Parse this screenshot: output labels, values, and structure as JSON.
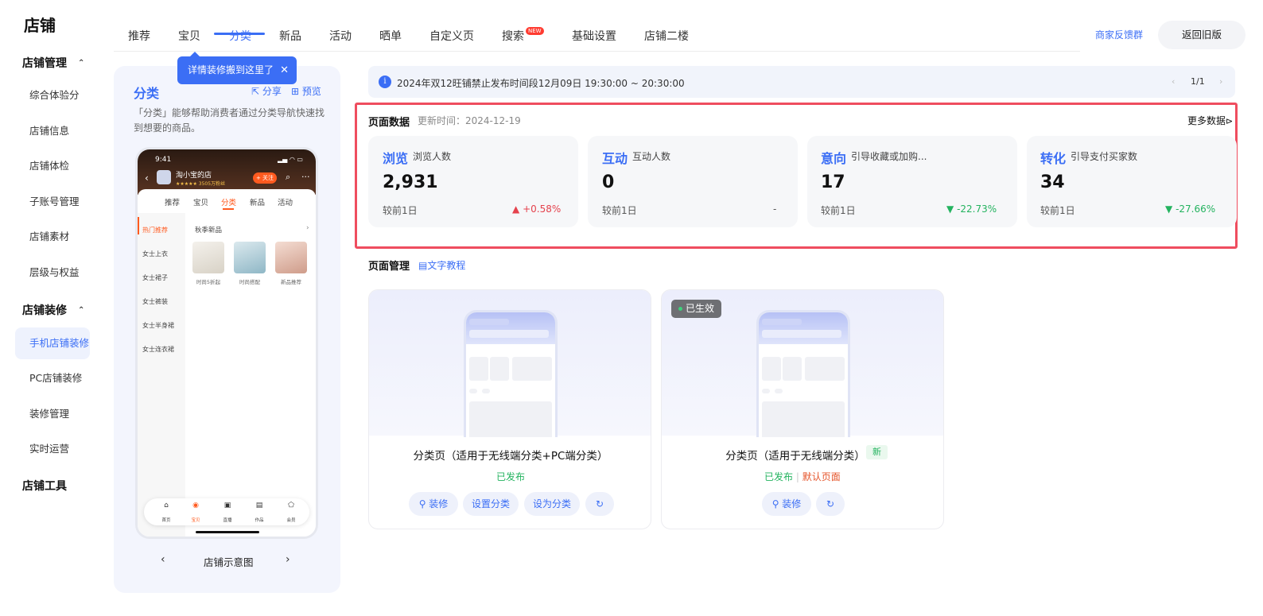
{
  "sidebar": {
    "title": "店铺",
    "group1": "店铺管理",
    "group1_items": [
      "综合体验分",
      "店铺信息",
      "店铺体检",
      "子账号管理",
      "店铺素材",
      "层级与权益"
    ],
    "group2": "店铺装修",
    "group2_items": [
      "手机店铺装修",
      "PC店铺装修",
      "装修管理",
      "实时运营"
    ],
    "group3": "店铺工具"
  },
  "topnav": {
    "tabs": [
      "推荐",
      "宝贝",
      "分类",
      "新品",
      "活动",
      "晒单",
      "自定义页",
      "搜索",
      "基础设置",
      "店铺二楼"
    ],
    "active_tab": "分类",
    "new_badge": "NEW",
    "feedback": "商家反馈群",
    "old_version": "返回旧版"
  },
  "tooltip": "详情装修搬到这里了",
  "preview": {
    "title": "分类",
    "share": "分享",
    "preview": "预览",
    "desc": "「分类」能够帮助消费者通过分类导航快速找到想要的商品。",
    "caption": "店铺示意图",
    "phone": {
      "time": "9:41",
      "shop_name": "淘小宝的店",
      "stars": "★★★★★ 3505万粉丝",
      "follow": "+ 关注",
      "tabs": [
        "推荐",
        "宝贝",
        "分类",
        "新品",
        "活动"
      ],
      "categories": [
        "热门推荐",
        "女士上衣",
        "女士裙子",
        "女士裤装",
        "女士半身裙",
        "女士连衣裙"
      ],
      "sub_title": "秋季新品",
      "products": [
        "时尚5折起",
        "时尚搭配",
        "新品推荐"
      ],
      "bottom_labels": [
        "首页",
        "宝贝",
        "直播",
        "作品",
        "会员"
      ]
    }
  },
  "notice": {
    "text": "2024年双12旺铺禁止发布时间段12月09日 19:30:00 ~ 20:30:00",
    "pager": "1/1"
  },
  "page_data": {
    "title": "页面数据",
    "update_time": "更新时间：2024-12-19",
    "more": "更多数据",
    "cards": [
      {
        "key": "浏览",
        "sub": "浏览人数",
        "value": "2,931",
        "compare": "较前1日",
        "delta": "+0.58%",
        "trend": "up"
      },
      {
        "key": "互动",
        "sub": "互动人数",
        "value": "0",
        "compare": "较前1日",
        "delta": "-",
        "trend": "flat"
      },
      {
        "key": "意向",
        "sub": "引导收藏或加购...",
        "value": "17",
        "compare": "较前1日",
        "delta": "-22.73%",
        "trend": "down"
      },
      {
        "key": "转化",
        "sub": "引导支付买家数",
        "value": "34",
        "compare": "较前1日",
        "delta": "-27.66%",
        "trend": "down"
      }
    ]
  },
  "page_mgmt": {
    "title": "页面管理",
    "tutorial": "文字教程",
    "templates": [
      {
        "name": "分类页（适用于无线端分类+PC端分类）",
        "status": "已发布",
        "buttons": [
          "装修",
          "设置分类",
          "设为分类"
        ]
      },
      {
        "name": "分类页（适用于无线端分类）",
        "status": "已发布",
        "default_label": "默认页面",
        "badge": "新",
        "live": "已生效",
        "buttons": [
          "装修"
        ]
      }
    ]
  },
  "colors": {
    "accent": "#3b6ef5",
    "highlight": "#ef4d5f",
    "up": "#e5424d",
    "down": "#24b35f"
  }
}
